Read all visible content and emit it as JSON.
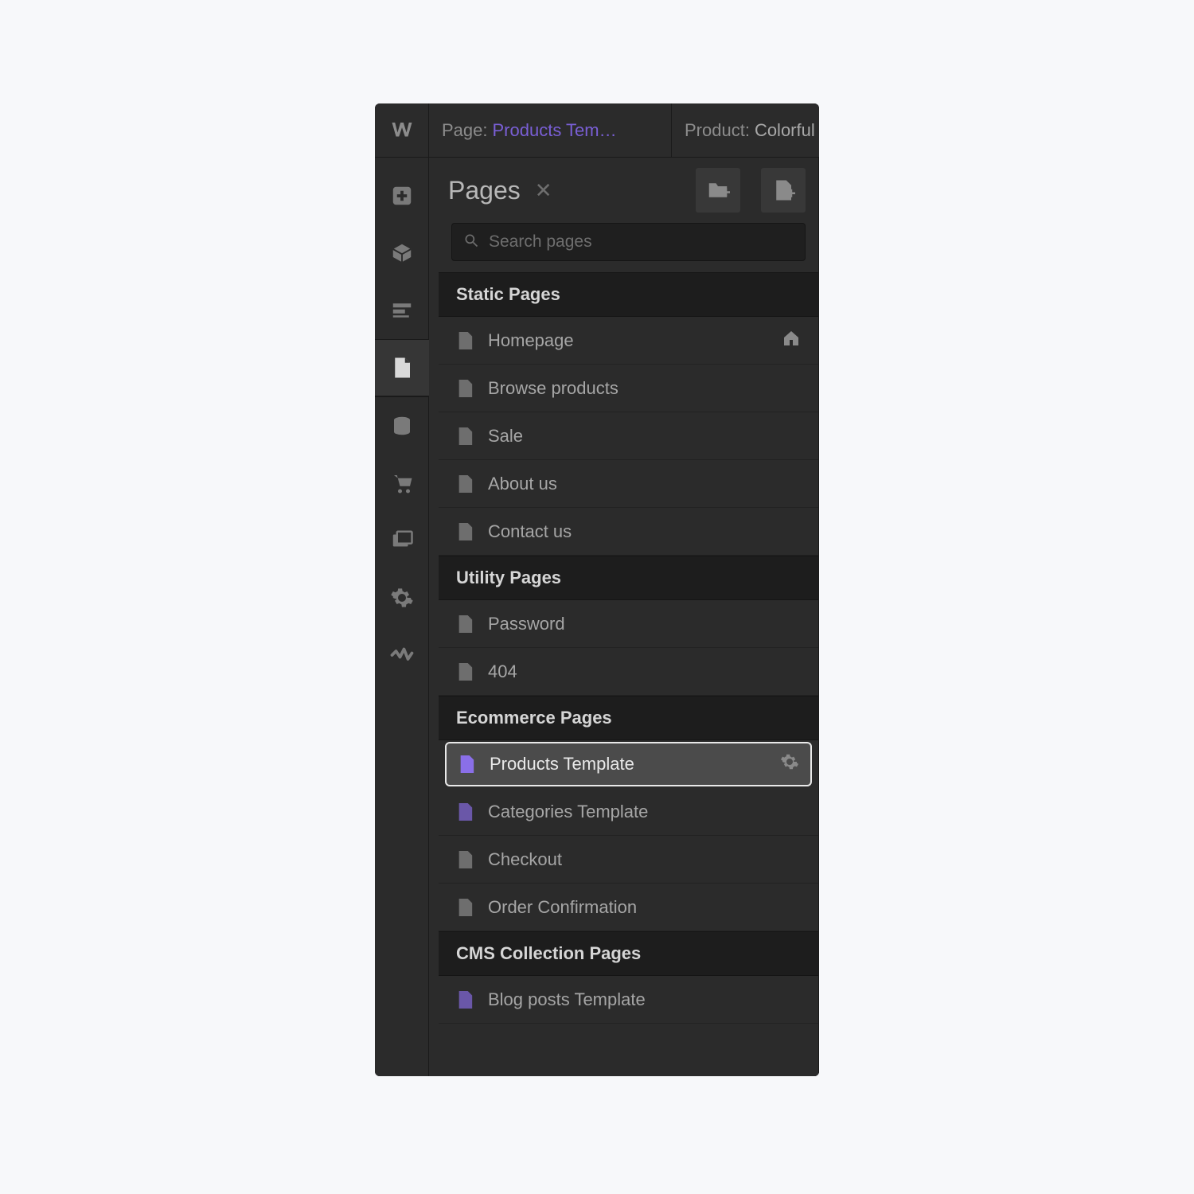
{
  "topbar": {
    "page_label": "Page:",
    "page_value": "Products Tem…",
    "product_label": "Product:",
    "product_value": "Colorful W"
  },
  "panel": {
    "title": "Pages",
    "search_placeholder": "Search pages"
  },
  "sections": [
    {
      "title": "Static Pages",
      "rows": [
        {
          "label": "Homepage",
          "icon": "gray",
          "right": "home"
        },
        {
          "label": "Browse products",
          "icon": "gray"
        },
        {
          "label": "Sale",
          "icon": "gray"
        },
        {
          "label": "About us",
          "icon": "gray"
        },
        {
          "label": "Contact us",
          "icon": "gray"
        }
      ]
    },
    {
      "title": "Utility Pages",
      "rows": [
        {
          "label": "Password",
          "icon": "gray"
        },
        {
          "label": "404",
          "icon": "gray"
        }
      ]
    },
    {
      "title": "Ecommerce Pages",
      "rows": [
        {
          "label": "Products Template",
          "icon": "purple",
          "selected": true,
          "right": "gear"
        },
        {
          "label": "Categories Template",
          "icon": "dimpurple"
        },
        {
          "label": "Checkout",
          "icon": "gray"
        },
        {
          "label": "Order Confirmation",
          "icon": "gray"
        }
      ]
    },
    {
      "title": "CMS Collection Pages",
      "rows": [
        {
          "label": "Blog posts Template",
          "icon": "dimpurple"
        }
      ]
    }
  ]
}
